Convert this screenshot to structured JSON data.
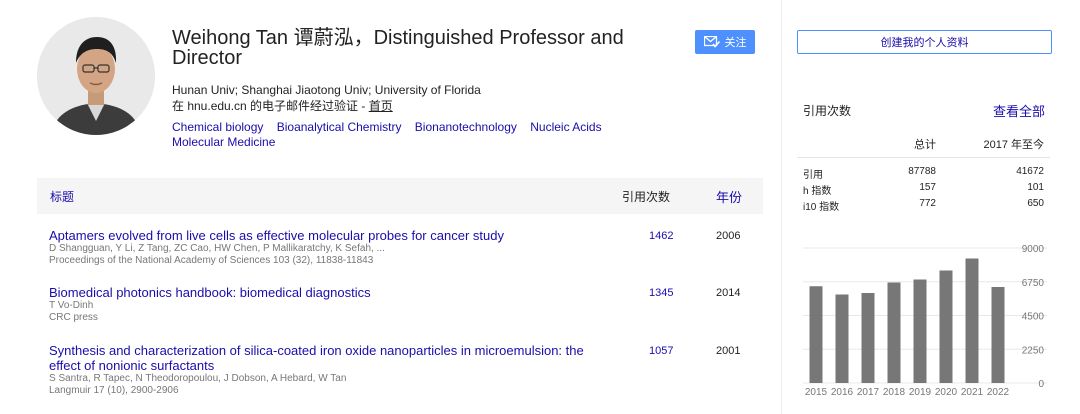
{
  "profile": {
    "name": "Weihong Tan 谭蔚泓，Distinguished Professor and Director",
    "affiliation": "Hunan Univ; Shanghai Jiaotong Univ; University of Florida",
    "verified_prefix": "在 hnu.edu.cn 的电子邮件经过验证 - ",
    "homepage_label": "首页",
    "follow_label": "关注",
    "interests": [
      "Chemical biology",
      "Bioanalytical Chemistry",
      "Bionanotechnology",
      "Nucleic Acids",
      "Molecular Medicine"
    ]
  },
  "table": {
    "col_title": "标题",
    "col_cited": "引用次数",
    "col_year": "年份"
  },
  "publications": [
    {
      "title": "Aptamers evolved from live cells as effective molecular probes for cancer study",
      "authors": "D Shangguan, Y Li, Z Tang, ZC Cao, HW Chen, P Mallikaratchy, K Sefah, ...",
      "venue": "Proceedings of the National Academy of Sciences 103 (32), 11838-11843",
      "cited": "1462",
      "year": "2006"
    },
    {
      "title": "Biomedical photonics handbook: biomedical diagnostics",
      "authors": "T Vo-Dinh",
      "venue": "CRC press",
      "cited": "1345",
      "year": "2014"
    },
    {
      "title": "Synthesis and characterization of silica-coated iron oxide nanoparticles in microemulsion: the effect of nonionic surfactants",
      "authors": "S Santra, R Tapec, N Theodoropoulou, J Dobson, A Hebard, W Tan",
      "venue": "Langmuir 17 (10), 2900-2906",
      "cited": "1057",
      "year": "2001"
    }
  ],
  "sidebar": {
    "create_profile": "创建我的个人资料",
    "cited_by": "引用次数",
    "view_all": "查看全部",
    "col_total": "总计",
    "col_since": "2017 年至今",
    "metrics": [
      {
        "label": "引用",
        "total": "87788",
        "since": "41672"
      },
      {
        "label": "h 指数",
        "total": "157",
        "since": "101"
      },
      {
        "label": "i10 指数",
        "total": "772",
        "since": "650"
      }
    ]
  },
  "chart_data": {
    "type": "bar",
    "categories": [
      "2015",
      "2016",
      "2017",
      "2018",
      "2019",
      "2020",
      "2021",
      "2022"
    ],
    "values": [
      6450,
      5900,
      6000,
      6700,
      6900,
      7500,
      8300,
      6400
    ],
    "ylim": [
      0,
      9000
    ],
    "yticks": [
      "9000",
      "6750",
      "4500",
      "2250",
      "0"
    ],
    "ytick_values": [
      9000,
      6750,
      4500,
      2250,
      0
    ],
    "bar_color": "#777777",
    "grid": true
  }
}
